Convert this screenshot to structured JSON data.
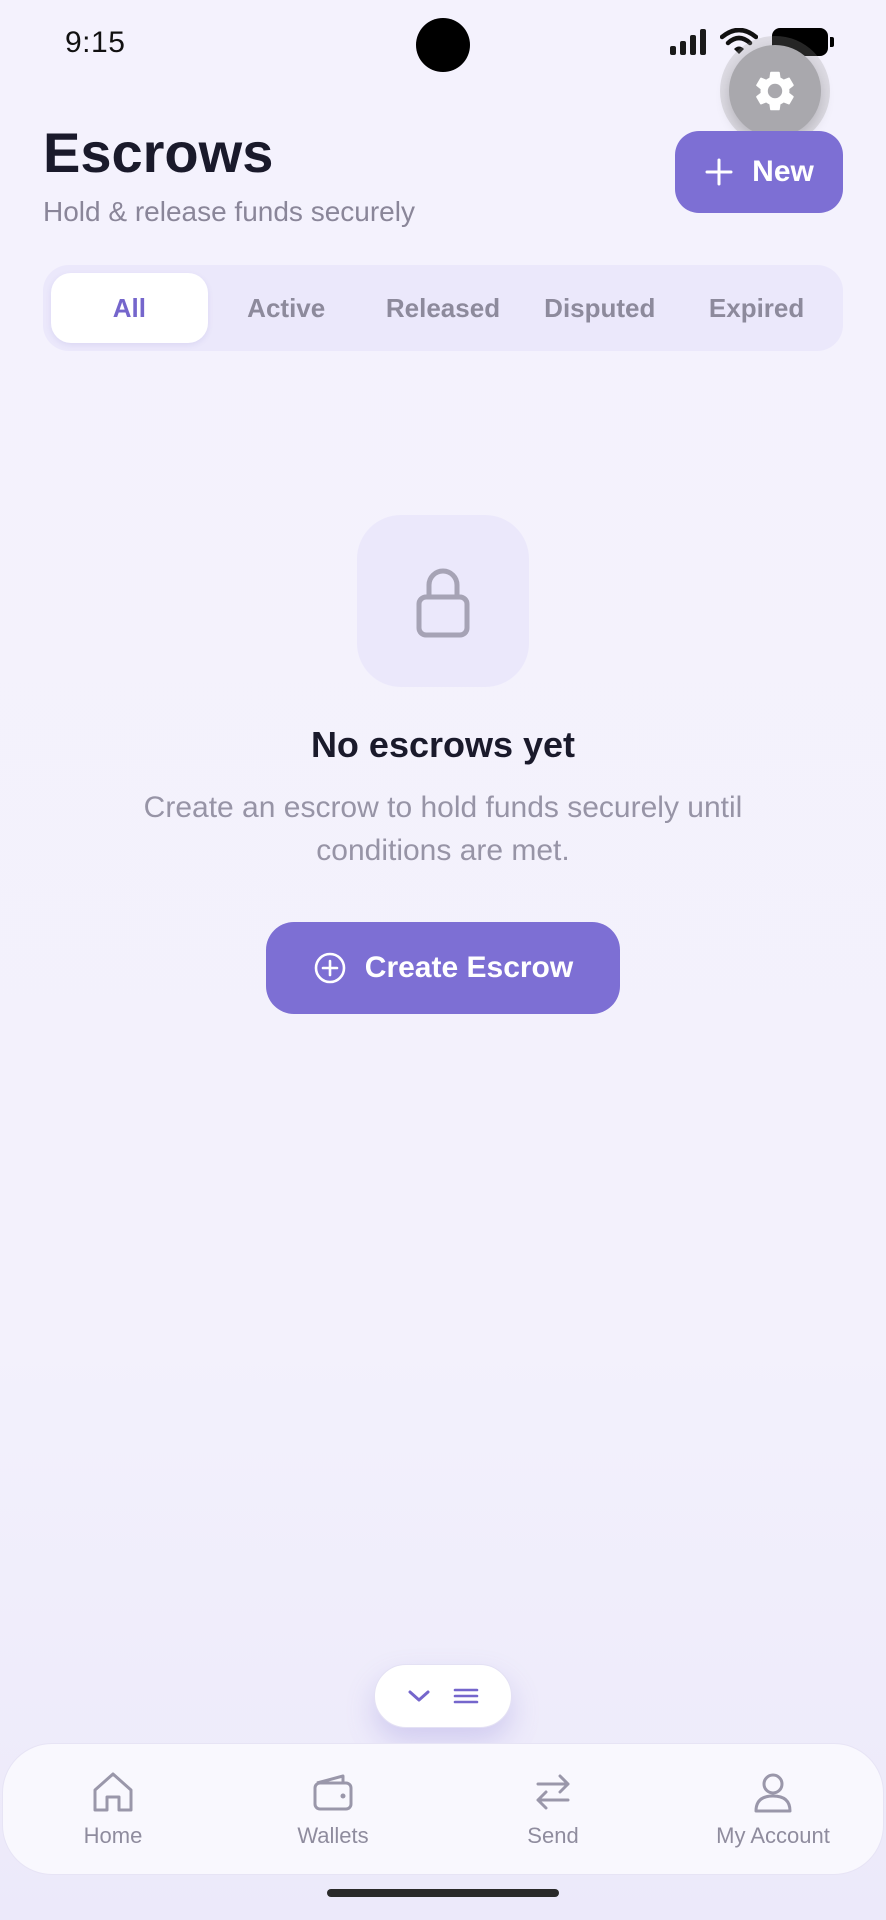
{
  "status_bar": {
    "time": "9:15"
  },
  "header": {
    "title": "Escrows",
    "subtitle": "Hold & release funds securely",
    "new_button_label": "New"
  },
  "tabs": [
    {
      "label": "All",
      "active": true
    },
    {
      "label": "Active",
      "active": false
    },
    {
      "label": "Released",
      "active": false
    },
    {
      "label": "Disputed",
      "active": false
    },
    {
      "label": "Expired",
      "active": false
    }
  ],
  "empty_state": {
    "icon": "lock-icon",
    "title": "No escrows yet",
    "description": "Create an escrow to hold funds securely until conditions are met.",
    "button_label": "Create Escrow"
  },
  "bottom_nav": [
    {
      "label": "Home",
      "icon": "home-icon"
    },
    {
      "label": "Wallets",
      "icon": "wallet-icon"
    },
    {
      "label": "Send",
      "icon": "swap-icon"
    },
    {
      "label": "My Account",
      "icon": "user-icon"
    }
  ],
  "colors": {
    "accent": "#7d6fd4",
    "active_tab_text": "#7566cc",
    "background": "#f3f1fc"
  }
}
